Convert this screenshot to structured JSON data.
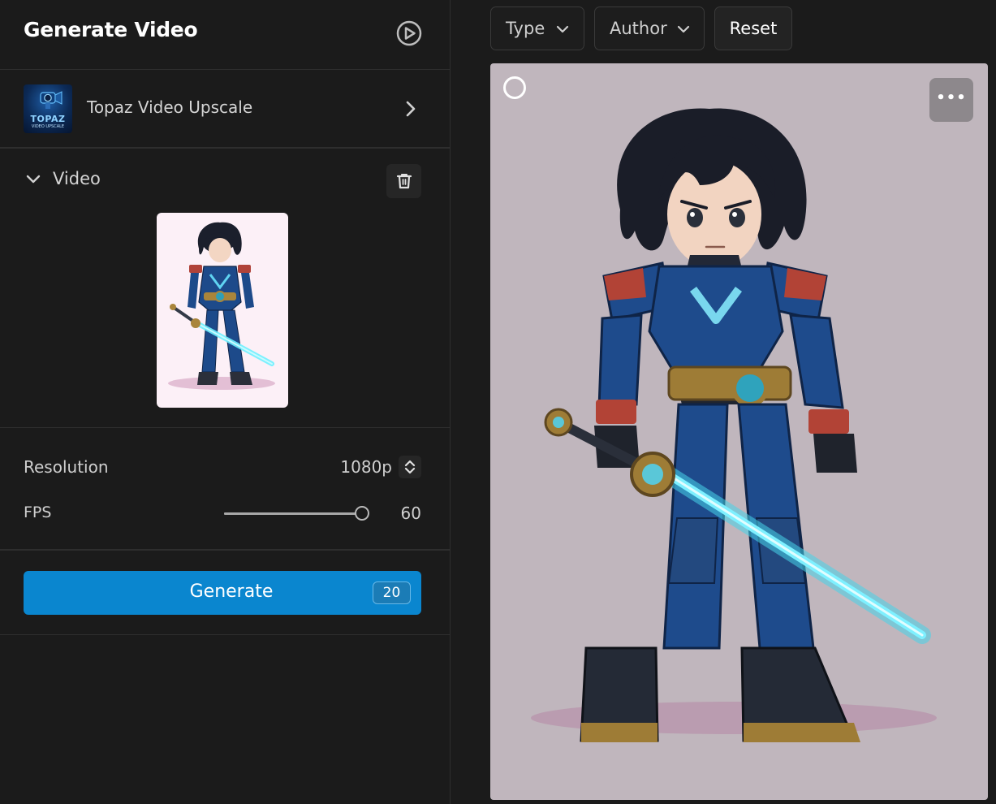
{
  "header": {
    "title": "Generate Video",
    "play_icon": "play-circle-icon"
  },
  "model": {
    "name": "Topaz Video Upscale",
    "thumb_title": "TOPAZ",
    "thumb_subtitle": "VIDEO UPSCALE",
    "chevron_icon": "chevron-right-icon"
  },
  "video": {
    "label": "Video",
    "toggle_icon": "chevron-down-icon",
    "delete_icon": "trash-icon",
    "thumbnail": "anime-armored-swordsman"
  },
  "settings": {
    "resolution_label": "Resolution",
    "resolution_value": "1080p",
    "fps_label": "FPS",
    "fps_value": "60",
    "fps_fraction": 1.0
  },
  "generate": {
    "label": "Generate",
    "cost": "20"
  },
  "filters": {
    "type_label": "Type",
    "author_label": "Author",
    "reset_label": "Reset"
  },
  "gallery": {
    "more_label": "•••",
    "image": "anime-armored-swordsman-large"
  },
  "colors": {
    "accent": "#0a86cf",
    "background": "#1b1b1b",
    "card_bg": "#c0b6bd"
  }
}
